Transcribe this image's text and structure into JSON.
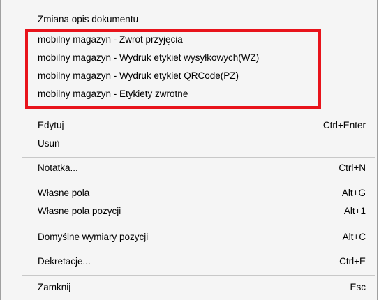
{
  "menu": {
    "items": [
      {
        "label": "Zmiana opis dokumentu",
        "shortcut": ""
      },
      {
        "label": "mobilny magazyn - Zwrot przyjęcia",
        "shortcut": ""
      },
      {
        "label": "mobilny magazyn - Wydruk etykiet wysyłkowych(WZ)",
        "shortcut": ""
      },
      {
        "label": "mobilny magazyn - Wydruk etykiet QRCode(PZ)",
        "shortcut": ""
      },
      {
        "label": "mobilny magazyn - Etykiety zwrotne",
        "shortcut": ""
      },
      {
        "label": "Edytuj",
        "shortcut": "Ctrl+Enter"
      },
      {
        "label": "Usuń",
        "shortcut": ""
      },
      {
        "label": "Notatka...",
        "shortcut": "Ctrl+N"
      },
      {
        "label": "Własne pola",
        "shortcut": "Alt+G"
      },
      {
        "label": "Własne pola pozycji",
        "shortcut": "Alt+1"
      },
      {
        "label": "Domyślne wymiary pozycji",
        "shortcut": "Alt+C"
      },
      {
        "label": "Dekretacje...",
        "shortcut": "Ctrl+E"
      },
      {
        "label": "Zamknij",
        "shortcut": "Esc"
      }
    ]
  },
  "colors": {
    "highlight_border": "#e8131b",
    "menu_background": "#f5f5f5",
    "separator": "#c8c8c8"
  }
}
